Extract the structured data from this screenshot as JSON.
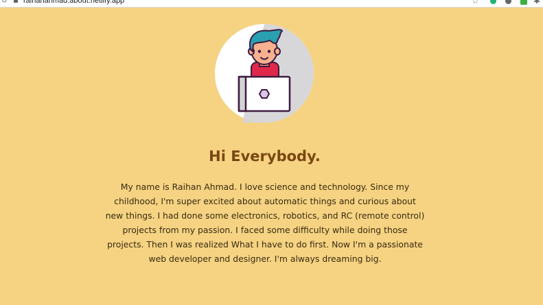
{
  "browser": {
    "url": "raihanahmad.about.netlify.app"
  },
  "hero": {
    "title": "Hi Everybody.",
    "intro": "My name is Raihan Ahmad. I love science and technology. Since my childhood, I'm super excited about automatic things and curious about new things. I had done some electronics, robotics, and RC (remote control) projects from my passion. I faced some difficulty while doing those projects. Then I was realized What I have to do first. Now I'm a passionate web developer and designer. I'm always dreaming big."
  },
  "colors": {
    "page_background": "#f5d382",
    "title": "#7a4712",
    "text": "#3a2a10"
  },
  "icons": {
    "avatar": "developer-with-laptop-avatar"
  }
}
